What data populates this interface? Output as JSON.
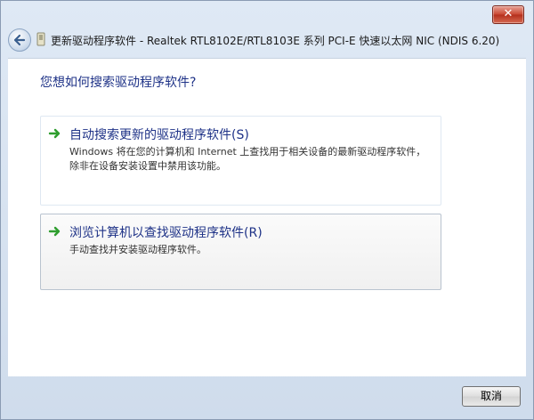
{
  "window": {
    "title": "更新驱动程序软件 - Realtek RTL8102E/RTL8103E 系列 PCI-E 快速以太网 NIC (NDIS 6.20)",
    "close_label": "✕"
  },
  "main": {
    "question": "您想如何搜索驱动程序软件?",
    "options": [
      {
        "title": "自动搜索更新的驱动程序软件(S)",
        "description": "Windows 将在您的计算机和 Internet 上查找用于相关设备的最新驱动程序软件，除非在设备安装设置中禁用该功能。"
      },
      {
        "title": "浏览计算机以查找驱动程序软件(R)",
        "description": "手动查找并安装驱动程序软件。"
      }
    ]
  },
  "footer": {
    "cancel_label": "取消"
  },
  "colors": {
    "heading": "#1e3287",
    "arrow": "#2f9e2f",
    "close": "#c8442f"
  }
}
